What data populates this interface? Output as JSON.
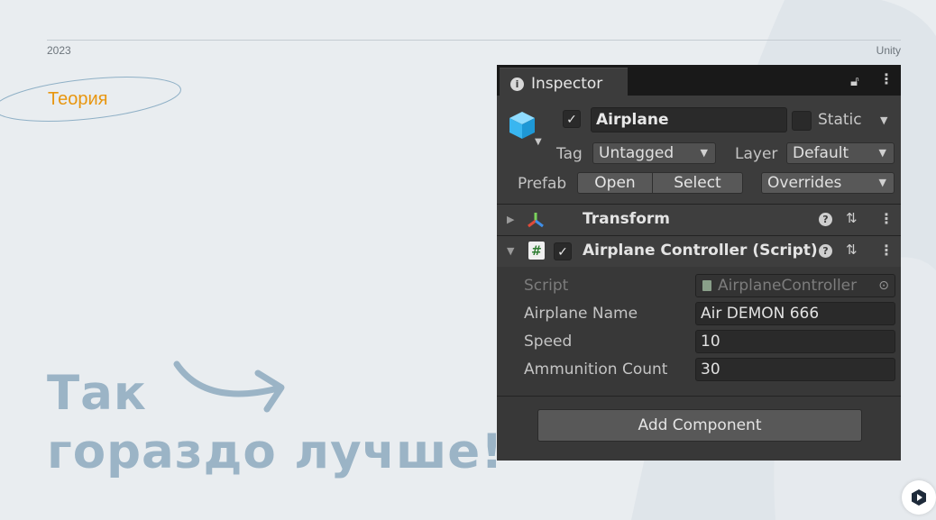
{
  "slide": {
    "year": "2023",
    "brand": "Unity",
    "section": "Теория",
    "headline_line1": "Так",
    "headline_line2": "гораздо лучше!"
  },
  "colors": {
    "background": "#e9edf0",
    "accent_orange": "#e8960f",
    "headline_blue": "#9bb4c6",
    "inspector_bg": "#383838"
  },
  "inspector": {
    "tab_label": "Inspector",
    "object": {
      "active": true,
      "name": "Airplane",
      "static_label": "Static",
      "static": false,
      "tag_label": "Tag",
      "tag_value": "Untagged",
      "layer_label": "Layer",
      "layer_value": "Default",
      "prefab_label": "Prefab",
      "open_label": "Open",
      "select_label": "Select",
      "overrides_label": "Overrides"
    },
    "components": [
      {
        "title": "Transform",
        "expanded": false,
        "icon": "transform-axes-icon"
      },
      {
        "title": "Airplane Controller (Script)",
        "expanded": true,
        "enabled": true,
        "icon": "script-hash-icon"
      }
    ],
    "properties": [
      {
        "label": "Script",
        "value": "AirplaneController",
        "readonly": true
      },
      {
        "label": "Airplane Name",
        "value": "Air DEMON 666"
      },
      {
        "label": "Speed",
        "value": "10"
      },
      {
        "label": "Ammunition Count",
        "value": "30"
      }
    ],
    "add_component_label": "Add Component"
  }
}
